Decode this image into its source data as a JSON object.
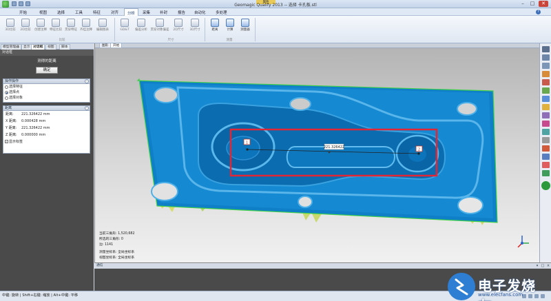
{
  "window": {
    "title": "Geomagic Qualify 2013 -- 选择 卡孔板.stl",
    "context_tab": "属性",
    "min": "–",
    "max": "□",
    "close": "✕"
  },
  "menu": {
    "items": [
      "开始",
      "视图",
      "选择",
      "工具",
      "特征",
      "对齐",
      "分析",
      "采集",
      "补封",
      "报告",
      "自动化",
      "多处理"
    ],
    "active_index": 6
  },
  "ribbon": {
    "buttons": [
      {
        "label": "3D比较",
        "bright": false
      },
      {
        "label": "2D比较",
        "bright": false
      },
      {
        "label": "创建注释",
        "bright": false
      },
      {
        "label": "特征比较",
        "bright": false
      },
      {
        "label": "贯穿特征",
        "bright": false
      },
      {
        "label": "齐挂注释",
        "bright": false
      },
      {
        "label": "编辑图表",
        "bright": false
      },
      {
        "label": "GD&T",
        "bright": false
      },
      {
        "label": "偏差分析",
        "bright": false
      },
      {
        "label": "贯穿对象偏差",
        "bright": false
      },
      {
        "label": "2D尺寸",
        "bright": false
      },
      {
        "label": "3D尺寸",
        "bright": false
      },
      {
        "label": "距离",
        "bright": true
      },
      {
        "label": "计算",
        "bright": true
      },
      {
        "label": "测量器",
        "bright": true
      }
    ],
    "groups": [
      "比较",
      "尺寸",
      "测量"
    ]
  },
  "left_panel": {
    "tabs": [
      "模型管理器",
      "显示",
      "对话框",
      "视图",
      "脚本"
    ],
    "active_tab_index": 2,
    "title": "对话框",
    "subtitle": "测得的距离",
    "ok_button": "确定",
    "section1": {
      "header": "操作操作",
      "options": [
        {
          "label": "选择特征",
          "selected": false
        },
        {
          "label": "选择点",
          "selected": true
        },
        {
          "label": "选择对象",
          "selected": false
        }
      ]
    },
    "section2": {
      "header": "距离",
      "rows": [
        {
          "label": "距离:",
          "value": "221.326422 mm"
        },
        {
          "label": "X 距离:",
          "value": "0.000428 mm"
        },
        {
          "label": "Y 距离:",
          "value": "221.326422 mm"
        },
        {
          "label": "Z 距离:",
          "value": "0.000000 mm"
        }
      ],
      "checkbox_label": "显示标签",
      "checkbox_checked": true
    }
  },
  "viewport": {
    "tabs": [
      "图形",
      "开始"
    ],
    "active_tab_index": 1,
    "measure_label": "221.326422",
    "point1_label": "1",
    "point2_label": "2",
    "info_lines": [
      "当前三角形: 1,520,682",
      "所选的三角形: 0",
      "边: 1141",
      "测量坐标系: 全局坐标系",
      "视图坐标系: 全局坐标系"
    ],
    "part_color": "#0f7fc8",
    "highlight_color": "#e32636"
  },
  "bottom_panel": {
    "header": "通信"
  },
  "status": {
    "text": "中键: 旋转 | Shift+右键: 缩放 | Alt+中键: 平移"
  },
  "watermark": {
    "text": "电子发烧友",
    "url": "www.elecfans.com"
  }
}
